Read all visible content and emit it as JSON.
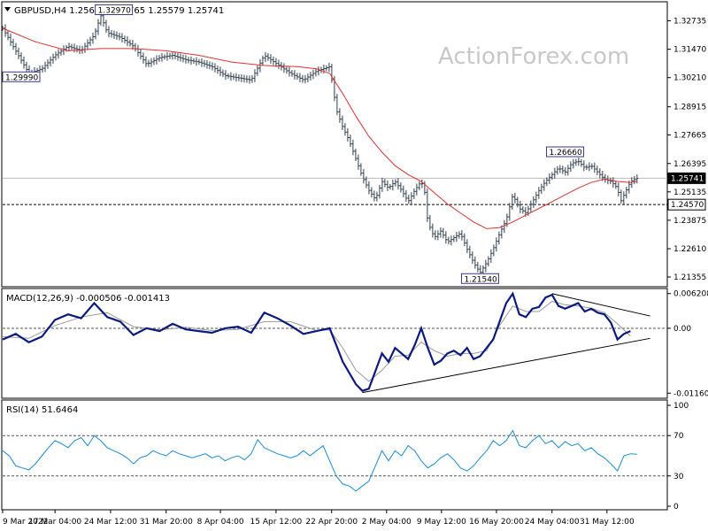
{
  "chart_data": [
    {
      "type": "candlestick",
      "panel": "price",
      "title": "GBPUSD,H4 1.25693 1.25765 1.25579 1.25741",
      "watermark": "ActionForex.com",
      "ylim": [
        1.21,
        1.335
      ],
      "yticks": [
        "1.32735",
        "1.31470",
        "1.30210",
        "1.28915",
        "1.27665",
        "1.26395",
        "1.25135",
        "1.23875",
        "1.22610",
        "1.21355"
      ],
      "last_price": "1.25741",
      "support_level": "1.24570",
      "annotations": [
        {
          "text": "1.32970",
          "value": 1.3297,
          "t": 0.17
        },
        {
          "text": "1.29990",
          "value": 1.2999,
          "t": 0.0
        },
        {
          "text": "1.26660",
          "value": 1.2666,
          "t": 0.86
        },
        {
          "text": "1.21540",
          "value": 1.2154,
          "t": 0.73
        }
      ],
      "close_path": [
        [
          0,
          1.324
        ],
        [
          0.02,
          1.314
        ],
        [
          0.04,
          1.304
        ],
        [
          0.06,
          1.306
        ],
        [
          0.08,
          1.312
        ],
        [
          0.1,
          1.316
        ],
        [
          0.12,
          1.314
        ],
        [
          0.14,
          1.321
        ],
        [
          0.15,
          1.3297
        ],
        [
          0.16,
          1.322
        ],
        [
          0.18,
          1.32
        ],
        [
          0.2,
          1.316
        ],
        [
          0.22,
          1.308
        ],
        [
          0.24,
          1.311
        ],
        [
          0.26,
          1.312
        ],
        [
          0.28,
          1.31
        ],
        [
          0.3,
          1.309
        ],
        [
          0.32,
          1.307
        ],
        [
          0.34,
          1.303
        ],
        [
          0.36,
          1.302
        ],
        [
          0.38,
          1.301
        ],
        [
          0.4,
          1.312
        ],
        [
          0.42,
          1.308
        ],
        [
          0.44,
          1.304
        ],
        [
          0.46,
          1.301
        ],
        [
          0.48,
          1.305
        ],
        [
          0.5,
          1.307
        ],
        [
          0.505,
          1.298
        ],
        [
          0.51,
          1.288
        ],
        [
          0.52,
          1.28
        ],
        [
          0.53,
          1.274
        ],
        [
          0.54,
          1.266
        ],
        [
          0.55,
          1.258
        ],
        [
          0.56,
          1.252
        ],
        [
          0.57,
          1.248
        ],
        [
          0.58,
          1.256
        ],
        [
          0.59,
          1.253
        ],
        [
          0.6,
          1.256
        ],
        [
          0.61,
          1.252
        ],
        [
          0.62,
          1.247
        ],
        [
          0.63,
          1.252
        ],
        [
          0.64,
          1.256
        ],
        [
          0.645,
          1.252
        ],
        [
          0.65,
          1.238
        ],
        [
          0.66,
          1.231
        ],
        [
          0.67,
          1.234
        ],
        [
          0.68,
          1.229
        ],
        [
          0.69,
          1.231
        ],
        [
          0.7,
          1.233
        ],
        [
          0.71,
          1.226
        ],
        [
          0.72,
          1.22
        ],
        [
          0.73,
          1.2154
        ],
        [
          0.74,
          1.22
        ],
        [
          0.75,
          1.226
        ],
        [
          0.76,
          1.233
        ],
        [
          0.77,
          1.239
        ],
        [
          0.78,
          1.25
        ],
        [
          0.79,
          1.244
        ],
        [
          0.8,
          1.242
        ],
        [
          0.81,
          1.247
        ],
        [
          0.82,
          1.252
        ],
        [
          0.83,
          1.256
        ],
        [
          0.84,
          1.259
        ],
        [
          0.85,
          1.262
        ],
        [
          0.86,
          1.26
        ],
        [
          0.87,
          1.264
        ],
        [
          0.88,
          1.265
        ],
        [
          0.89,
          1.262
        ],
        [
          0.9,
          1.263
        ],
        [
          0.91,
          1.26
        ],
        [
          0.92,
          1.257
        ],
        [
          0.93,
          1.256
        ],
        [
          0.94,
          1.253
        ],
        [
          0.945,
          1.247
        ],
        [
          0.95,
          1.25
        ],
        [
          0.96,
          1.256
        ],
        [
          0.97,
          1.2574
        ]
      ],
      "ma_path": [
        [
          0,
          1.324
        ],
        [
          0.05,
          1.318
        ],
        [
          0.1,
          1.314
        ],
        [
          0.15,
          1.315
        ],
        [
          0.2,
          1.315
        ],
        [
          0.25,
          1.314
        ],
        [
          0.3,
          1.312
        ],
        [
          0.35,
          1.309
        ],
        [
          0.4,
          1.3075
        ],
        [
          0.45,
          1.307
        ],
        [
          0.48,
          1.306
        ],
        [
          0.5,
          1.304
        ],
        [
          0.52,
          1.295
        ],
        [
          0.54,
          1.285
        ],
        [
          0.56,
          1.276
        ],
        [
          0.58,
          1.269
        ],
        [
          0.6,
          1.263
        ],
        [
          0.62,
          1.259
        ],
        [
          0.64,
          1.256
        ],
        [
          0.66,
          1.251
        ],
        [
          0.68,
          1.246
        ],
        [
          0.7,
          1.242
        ],
        [
          0.72,
          1.238
        ],
        [
          0.74,
          1.235
        ],
        [
          0.76,
          1.2355
        ],
        [
          0.78,
          1.238
        ],
        [
          0.8,
          1.241
        ],
        [
          0.82,
          1.244
        ],
        [
          0.84,
          1.247
        ],
        [
          0.86,
          1.25
        ],
        [
          0.88,
          1.253
        ],
        [
          0.9,
          1.2555
        ],
        [
          0.92,
          1.257
        ],
        [
          0.94,
          1.256
        ],
        [
          0.96,
          1.2555
        ],
        [
          0.97,
          1.256
        ]
      ]
    },
    {
      "type": "line",
      "panel": "macd",
      "label": "MACD(12,26,9) -0.000506 -0.001413",
      "ylim": [
        -0.0122,
        0.0068
      ],
      "yticks": [
        "0.006208",
        "0.00",
        "-0.011607"
      ],
      "macd_path": [
        [
          0,
          -0.002
        ],
        [
          0.02,
          -0.001
        ],
        [
          0.04,
          -0.0025
        ],
        [
          0.06,
          -0.0015
        ],
        [
          0.08,
          0.0015
        ],
        [
          0.1,
          0.0025
        ],
        [
          0.12,
          0.0018
        ],
        [
          0.14,
          0.0045
        ],
        [
          0.16,
          0.002
        ],
        [
          0.18,
          0.0012
        ],
        [
          0.2,
          -0.0012
        ],
        [
          0.22,
          0.0
        ],
        [
          0.24,
          -0.0005
        ],
        [
          0.26,
          0.0008
        ],
        [
          0.28,
          -0.0002
        ],
        [
          0.3,
          -0.0005
        ],
        [
          0.32,
          -0.0008
        ],
        [
          0.34,
          0.0
        ],
        [
          0.36,
          0.0003
        ],
        [
          0.38,
          -0.0008
        ],
        [
          0.4,
          0.0028
        ],
        [
          0.42,
          0.0018
        ],
        [
          0.44,
          0.0005
        ],
        [
          0.46,
          -0.001
        ],
        [
          0.48,
          -0.0005
        ],
        [
          0.5,
          0.0
        ],
        [
          0.52,
          -0.006
        ],
        [
          0.54,
          -0.01
        ],
        [
          0.55,
          -0.0112
        ],
        [
          0.56,
          -0.0108
        ],
        [
          0.58,
          -0.0045
        ],
        [
          0.59,
          -0.006
        ],
        [
          0.6,
          -0.0035
        ],
        [
          0.62,
          -0.0055
        ],
        [
          0.63,
          -0.003
        ],
        [
          0.64,
          0.0
        ],
        [
          0.65,
          -0.0035
        ],
        [
          0.66,
          -0.0065
        ],
        [
          0.67,
          -0.0058
        ],
        [
          0.68,
          -0.0045
        ],
        [
          0.69,
          -0.004
        ],
        [
          0.7,
          -0.0048
        ],
        [
          0.71,
          -0.0035
        ],
        [
          0.72,
          -0.0055
        ],
        [
          0.73,
          -0.005
        ],
        [
          0.75,
          -0.002
        ],
        [
          0.77,
          0.0045
        ],
        [
          0.78,
          0.0062
        ],
        [
          0.79,
          0.0025
        ],
        [
          0.8,
          0.002
        ],
        [
          0.81,
          0.0035
        ],
        [
          0.82,
          0.0038
        ],
        [
          0.83,
          0.0055
        ],
        [
          0.84,
          0.006
        ],
        [
          0.85,
          0.004
        ],
        [
          0.86,
          0.0035
        ],
        [
          0.87,
          0.004
        ],
        [
          0.88,
          0.0045
        ],
        [
          0.89,
          0.003
        ],
        [
          0.9,
          0.0035
        ],
        [
          0.91,
          0.0028
        ],
        [
          0.92,
          0.0025
        ],
        [
          0.93,
          0.001
        ],
        [
          0.94,
          -0.002
        ],
        [
          0.95,
          -0.001
        ],
        [
          0.96,
          -0.0005
        ]
      ],
      "signal_path": [
        [
          0,
          -0.0015
        ],
        [
          0.04,
          -0.0018
        ],
        [
          0.08,
          0.0005
        ],
        [
          0.12,
          0.002
        ],
        [
          0.16,
          0.0028
        ],
        [
          0.2,
          0.0003
        ],
        [
          0.24,
          -0.0003
        ],
        [
          0.28,
          0.0002
        ],
        [
          0.32,
          -0.0004
        ],
        [
          0.36,
          -0.0002
        ],
        [
          0.4,
          0.0012
        ],
        [
          0.44,
          0.0012
        ],
        [
          0.48,
          -0.0004
        ],
        [
          0.5,
          -0.0003
        ],
        [
          0.52,
          -0.0035
        ],
        [
          0.54,
          -0.0075
        ],
        [
          0.56,
          -0.0095
        ],
        [
          0.58,
          -0.0075
        ],
        [
          0.6,
          -0.005
        ],
        [
          0.62,
          -0.0048
        ],
        [
          0.64,
          -0.0025
        ],
        [
          0.66,
          -0.004
        ],
        [
          0.68,
          -0.005
        ],
        [
          0.7,
          -0.0045
        ],
        [
          0.72,
          -0.0045
        ],
        [
          0.74,
          -0.004
        ],
        [
          0.76,
          0.0005
        ],
        [
          0.78,
          0.004
        ],
        [
          0.8,
          0.003
        ],
        [
          0.82,
          0.003
        ],
        [
          0.84,
          0.0048
        ],
        [
          0.86,
          0.0042
        ],
        [
          0.88,
          0.004
        ],
        [
          0.9,
          0.0036
        ],
        [
          0.92,
          0.0028
        ],
        [
          0.94,
          0.0008
        ],
        [
          0.96,
          -0.0014
        ]
      ],
      "trendlines": [
        {
          "from": [
            0.55,
            -0.0115
          ],
          "to": [
            0.99,
            -0.0018
          ]
        },
        {
          "from": [
            0.84,
            0.0062
          ],
          "to": [
            0.99,
            0.0022
          ]
        }
      ]
    },
    {
      "type": "line",
      "panel": "rsi",
      "label": "RSI(14) 51.6464",
      "ylim": [
        0,
        100
      ],
      "yticks": [
        "100",
        "70",
        "30",
        "0"
      ],
      "ylevels": [
        70,
        30
      ],
      "path": [
        [
          0,
          55
        ],
        [
          0.01,
          50
        ],
        [
          0.02,
          40
        ],
        [
          0.03,
          38
        ],
        [
          0.04,
          36
        ],
        [
          0.05,
          42
        ],
        [
          0.06,
          50
        ],
        [
          0.07,
          58
        ],
        [
          0.08,
          65
        ],
        [
          0.09,
          62
        ],
        [
          0.1,
          58
        ],
        [
          0.11,
          65
        ],
        [
          0.12,
          68
        ],
        [
          0.13,
          60
        ],
        [
          0.14,
          70
        ],
        [
          0.15,
          65
        ],
        [
          0.16,
          58
        ],
        [
          0.17,
          55
        ],
        [
          0.18,
          52
        ],
        [
          0.19,
          48
        ],
        [
          0.2,
          42
        ],
        [
          0.21,
          48
        ],
        [
          0.22,
          50
        ],
        [
          0.23,
          55
        ],
        [
          0.24,
          52
        ],
        [
          0.25,
          50
        ],
        [
          0.26,
          55
        ],
        [
          0.27,
          52
        ],
        [
          0.28,
          50
        ],
        [
          0.29,
          48
        ],
        [
          0.3,
          50
        ],
        [
          0.31,
          52
        ],
        [
          0.32,
          48
        ],
        [
          0.33,
          50
        ],
        [
          0.34,
          45
        ],
        [
          0.35,
          48
        ],
        [
          0.36,
          50
        ],
        [
          0.37,
          46
        ],
        [
          0.38,
          52
        ],
        [
          0.39,
          66
        ],
        [
          0.4,
          58
        ],
        [
          0.41,
          55
        ],
        [
          0.42,
          52
        ],
        [
          0.43,
          50
        ],
        [
          0.44,
          48
        ],
        [
          0.45,
          50
        ],
        [
          0.46,
          55
        ],
        [
          0.47,
          50
        ],
        [
          0.48,
          55
        ],
        [
          0.49,
          60
        ],
        [
          0.5,
          45
        ],
        [
          0.51,
          30
        ],
        [
          0.52,
          22
        ],
        [
          0.53,
          20
        ],
        [
          0.54,
          15
        ],
        [
          0.55,
          20
        ],
        [
          0.56,
          25
        ],
        [
          0.57,
          40
        ],
        [
          0.58,
          55
        ],
        [
          0.59,
          45
        ],
        [
          0.6,
          55
        ],
        [
          0.61,
          50
        ],
        [
          0.62,
          60
        ],
        [
          0.63,
          55
        ],
        [
          0.64,
          45
        ],
        [
          0.65,
          38
        ],
        [
          0.66,
          42
        ],
        [
          0.67,
          48
        ],
        [
          0.68,
          52
        ],
        [
          0.69,
          46
        ],
        [
          0.7,
          38
        ],
        [
          0.71,
          35
        ],
        [
          0.72,
          40
        ],
        [
          0.73,
          48
        ],
        [
          0.74,
          55
        ],
        [
          0.75,
          65
        ],
        [
          0.76,
          60
        ],
        [
          0.77,
          65
        ],
        [
          0.78,
          75
        ],
        [
          0.79,
          60
        ],
        [
          0.8,
          58
        ],
        [
          0.81,
          65
        ],
        [
          0.82,
          70
        ],
        [
          0.83,
          62
        ],
        [
          0.84,
          65
        ],
        [
          0.85,
          58
        ],
        [
          0.86,
          64
        ],
        [
          0.87,
          60
        ],
        [
          0.88,
          62
        ],
        [
          0.89,
          55
        ],
        [
          0.9,
          58
        ],
        [
          0.91,
          52
        ],
        [
          0.92,
          48
        ],
        [
          0.93,
          42
        ],
        [
          0.94,
          35
        ],
        [
          0.95,
          50
        ],
        [
          0.96,
          52
        ],
        [
          0.97,
          51.6
        ]
      ]
    }
  ],
  "x_axis": {
    "ticks": [
      {
        "label": "9 Mar 2022",
        "t": 0.0
      },
      {
        "label": "17 Mar 04:00",
        "t": 0.08
      },
      {
        "label": "24 Mar 12:00",
        "t": 0.165
      },
      {
        "label": "31 Mar 20:00",
        "t": 0.25
      },
      {
        "label": "8 Apr 04:00",
        "t": 0.333
      },
      {
        "label": "15 Apr 12:00",
        "t": 0.418
      },
      {
        "label": "22 Apr 20:00",
        "t": 0.503
      },
      {
        "label": "2 May 04:00",
        "t": 0.587
      },
      {
        "label": "9 May 12:00",
        "t": 0.671
      },
      {
        "label": "16 May 20:00",
        "t": 0.755
      },
      {
        "label": "24 May 04:00",
        "t": 0.84
      },
      {
        "label": "31 May 12:00",
        "t": 0.924
      }
    ]
  },
  "colors": {
    "price": "#2f3f4f",
    "ma": "#e03030",
    "macd": "#0a1a80",
    "signal": "#9a9a9a",
    "rsi": "#1a8cd8",
    "grid_dash": "#555555"
  },
  "triangle_icon": "dropdown-triangle-icon"
}
